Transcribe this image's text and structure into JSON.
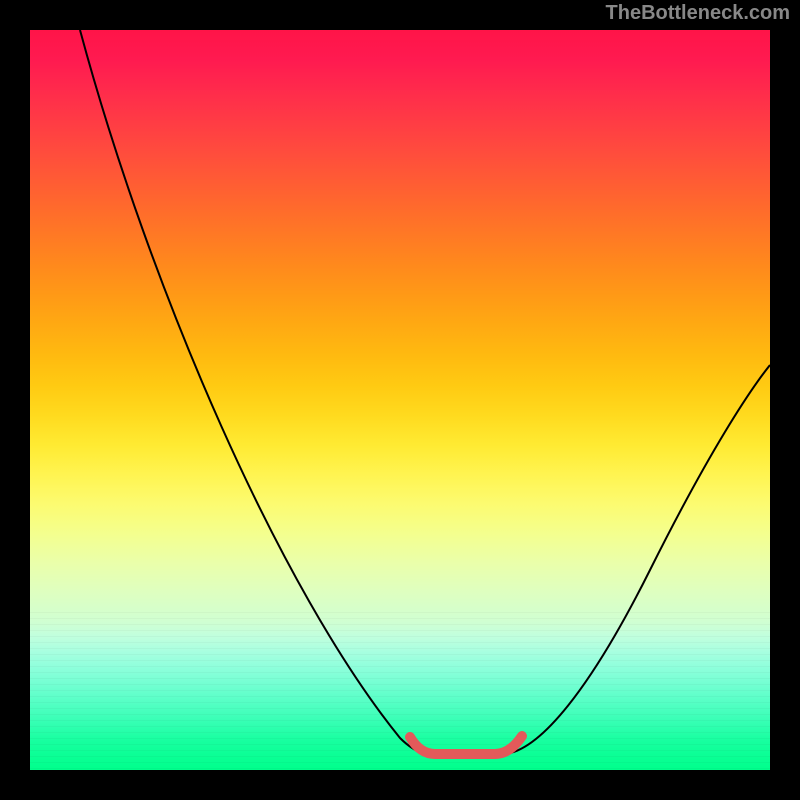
{
  "watermark": "TheBottleneck.com",
  "chart_data": {
    "type": "line",
    "title": "",
    "xlabel": "",
    "ylabel": "",
    "xlim": [
      0,
      100
    ],
    "ylim": [
      0,
      100
    ],
    "grid": false,
    "legend": false,
    "background": "rainbow-gradient-vertical",
    "series": [
      {
        "name": "bottleneck-curve",
        "x": [
          7,
          12,
          18,
          24,
          30,
          36,
          42,
          48,
          53,
          58,
          62,
          64,
          68,
          74,
          80,
          86,
          92,
          98,
          100
        ],
        "y": [
          100,
          84,
          68,
          54,
          42,
          32,
          24,
          16,
          9,
          4,
          2,
          2,
          4,
          10,
          20,
          32,
          44,
          54,
          58
        ]
      }
    ],
    "annotations": [
      {
        "name": "optimal-range",
        "type": "highlight-segment",
        "color": "#e35a5a",
        "x_range": [
          51,
          66
        ],
        "y": 2
      }
    ]
  }
}
